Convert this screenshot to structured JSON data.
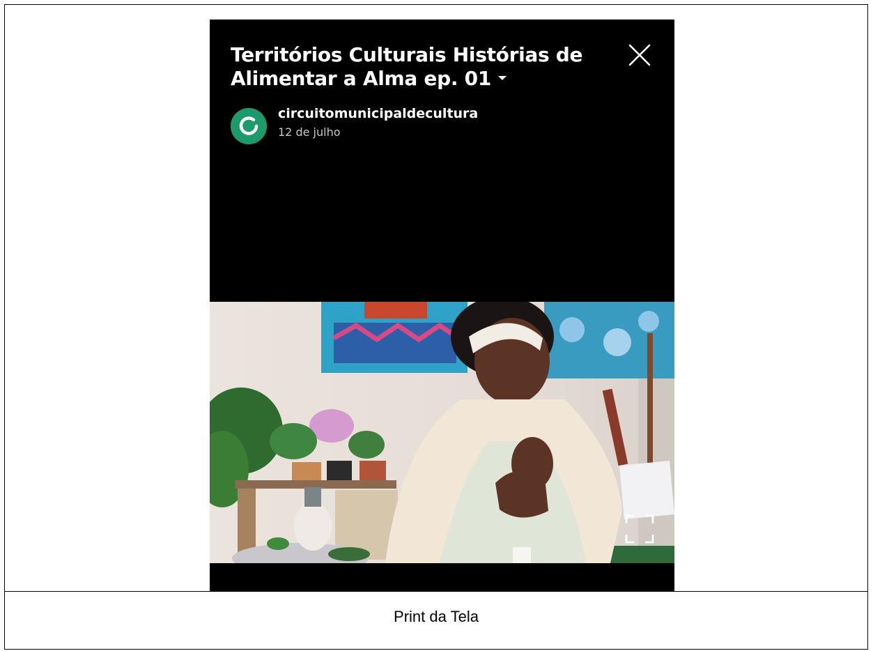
{
  "video": {
    "title": "Territórios Culturais  Histórias de Alimentar a Alma ep. 01",
    "channel": "circuitomunicipaldecultura",
    "date": "12 de julho",
    "avatar_color": "#1c9a6b"
  },
  "icons": {
    "close": "close-icon",
    "dropdown": "chevron-down-icon",
    "fullscreen": "fullscreen-icon"
  },
  "caption": "Print da Tela"
}
